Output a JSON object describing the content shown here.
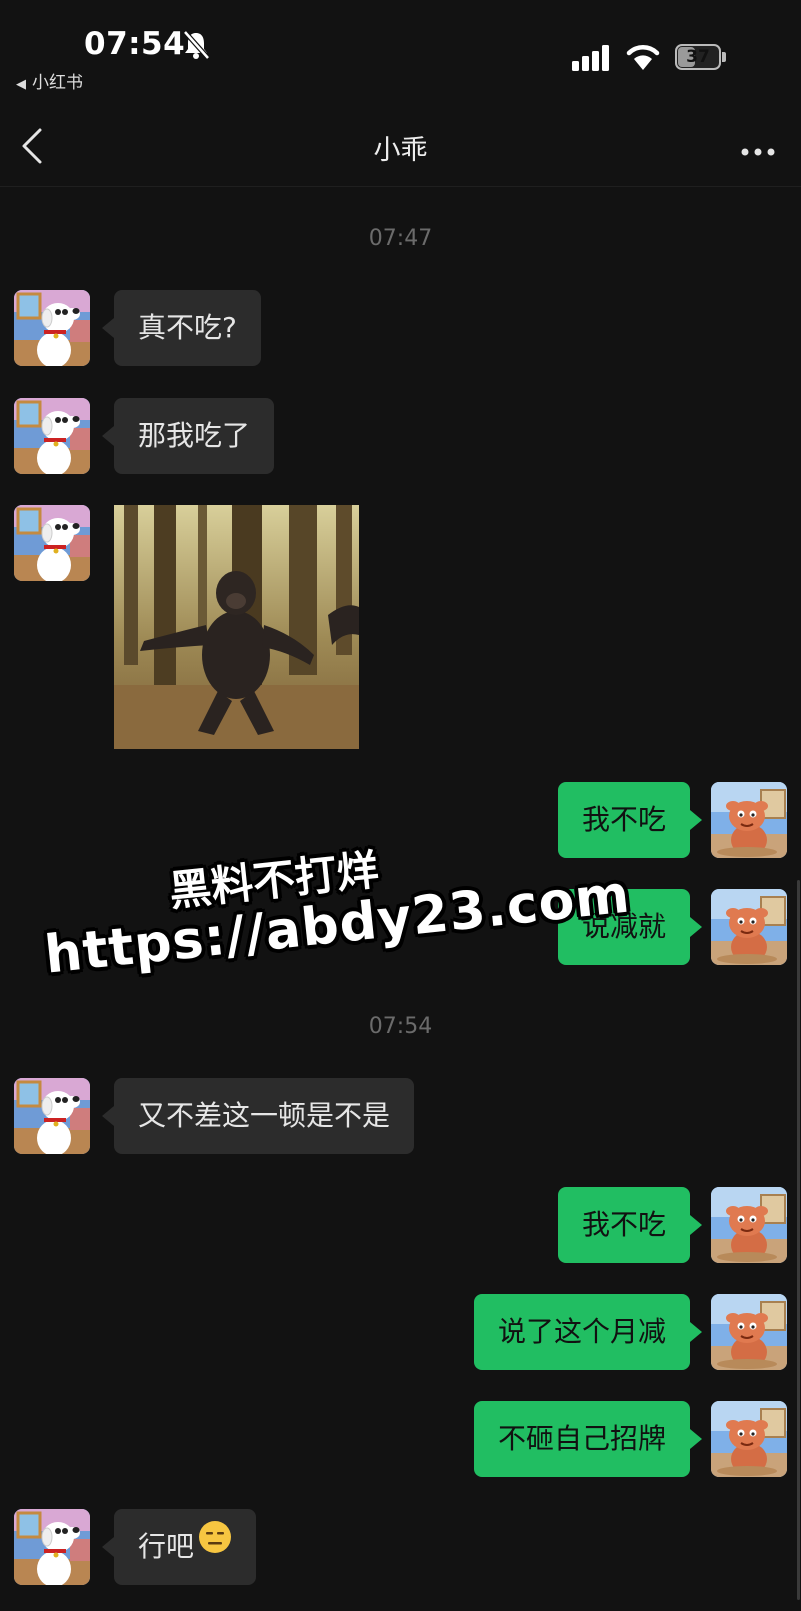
{
  "status_bar": {
    "time": "07:54",
    "back_app": "小红书",
    "battery": "37",
    "icons": [
      "bell-off-icon",
      "signal-icon",
      "wifi-icon",
      "battery-icon"
    ]
  },
  "header": {
    "title": "小乖",
    "icons": [
      "back-chevron-icon",
      "more-dots-icon"
    ]
  },
  "messages": [
    {
      "type": "timestamp",
      "text": "07:47"
    },
    {
      "type": "incoming",
      "text": "真不吃?"
    },
    {
      "type": "incoming",
      "text": "那我吃了"
    },
    {
      "type": "incoming-image",
      "text": ""
    },
    {
      "type": "outgoing",
      "text": "我不吃"
    },
    {
      "type": "outgoing",
      "text": "说减就"
    },
    {
      "type": "timestamp",
      "text": "07:54"
    },
    {
      "type": "incoming",
      "text": "又不差这一顿是不是"
    },
    {
      "type": "outgoing",
      "text": "我不吃"
    },
    {
      "type": "outgoing",
      "text": "说了这个月减"
    },
    {
      "type": "outgoing",
      "text": "不砸自己招牌"
    },
    {
      "type": "incoming",
      "text": "行吧",
      "emoji": "expressionless-face-icon"
    }
  ],
  "watermark": {
    "line1": "黑料不打烊",
    "line2": "https://abdy23.com"
  },
  "colors": {
    "background": "#121212",
    "incoming_bubble": "#2c2c2c",
    "outgoing_bubble": "#21be62"
  }
}
